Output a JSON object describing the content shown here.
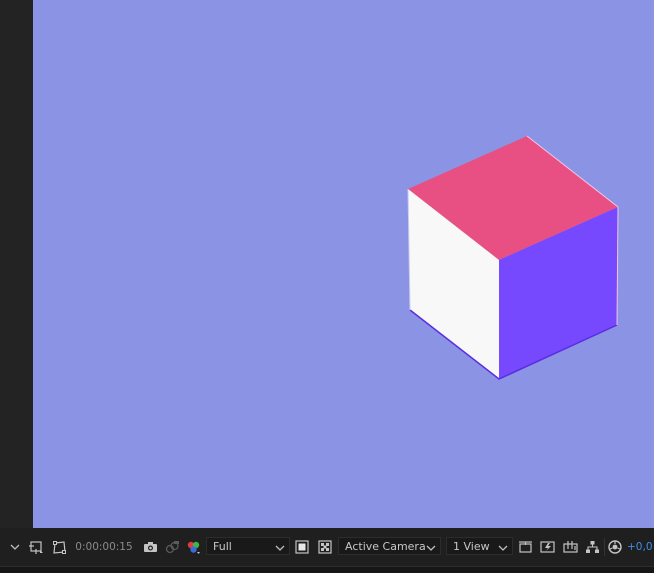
{
  "viewer": {
    "background_color": "#8b94e4",
    "cube": {
      "top_color": "#e85083",
      "left_color": "#f8f8f8",
      "right_color": "#7649ff",
      "edge_color": "#5a2ee0"
    }
  },
  "toolbar": {
    "timecode": "0:00:00:15",
    "resolution": "Full",
    "camera": "Active Camera",
    "views": "1 View",
    "exposure": "+0,0"
  },
  "icons": {
    "menu_chevron": "chevron-down-icon",
    "region_of_interest": "region-of-interest-icon",
    "mask_toggle": "mask-icon",
    "snapshot": "camera-icon",
    "show_snapshot": "show-snapshot-icon",
    "channels": "color-channels-icon",
    "fast_preview": "fast-preview-icon",
    "transparency_grid": "transparency-grid-icon",
    "reset_exposure": "reset-exposure-icon"
  }
}
